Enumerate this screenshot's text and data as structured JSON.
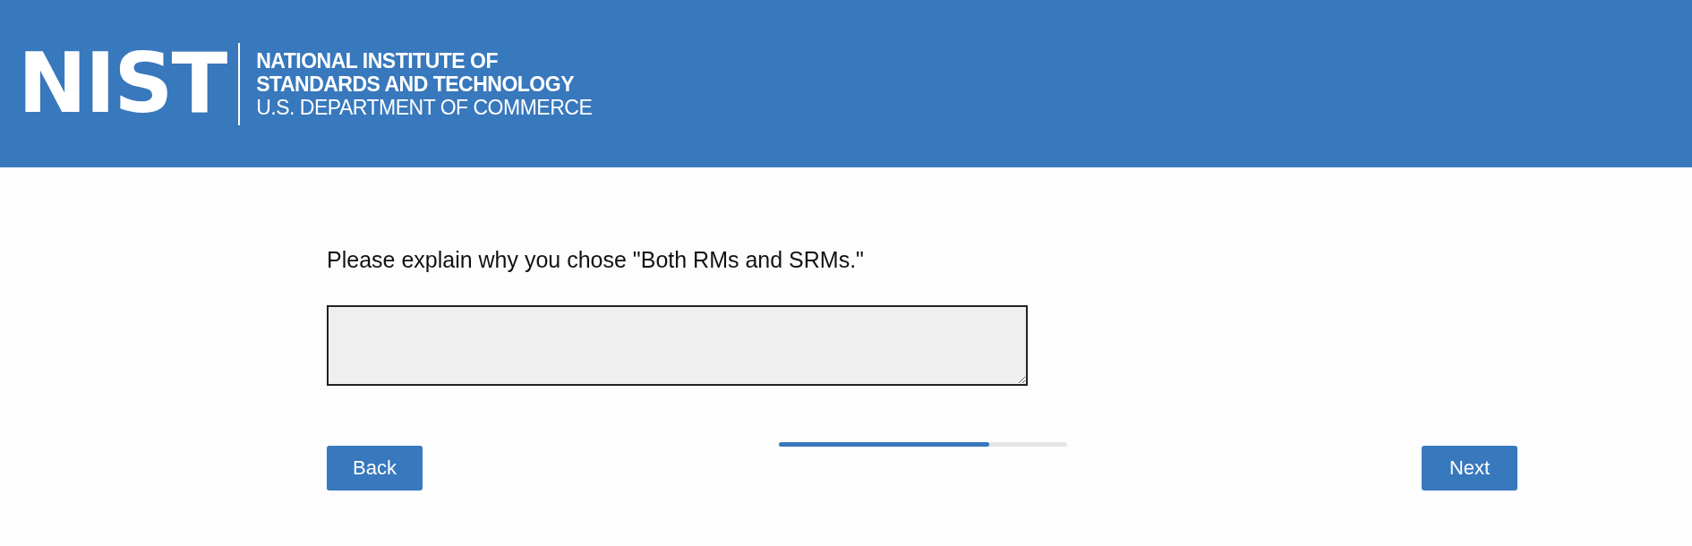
{
  "header": {
    "logo_text": "NIST",
    "org_lines": [
      "NATIONAL INSTITUTE OF",
      "STANDARDS AND TECHNOLOGY",
      "U.S. DEPARTMENT OF COMMERCE"
    ]
  },
  "question": {
    "text": "Please explain why you chose \"Both RMs and SRMs.\""
  },
  "progress": {
    "level": 0.73
  },
  "buttons": [
    {
      "label": "Back",
      "kind": "back"
    },
    {
      "label": "Next",
      "kind": "next"
    }
  ]
}
